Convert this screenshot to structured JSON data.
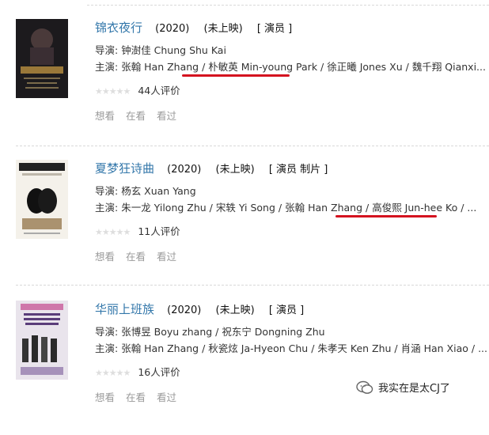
{
  "movies": [
    {
      "title": "锦衣夜行",
      "year": "(2020)",
      "status": "(未上映)",
      "roles": "[ 演员 ]",
      "director_label": "导演: ",
      "director": "钟澍佳 Chung Shu Kai",
      "cast_label": "主演: ",
      "cast": [
        "张翰 Han Zhang",
        "朴敏英 Min-young Park",
        "徐正曦 Jones Xu",
        "魏千翔 Qianxi..."
      ],
      "rating_count": "44人评价",
      "actions": [
        "想看",
        "在看",
        "看过"
      ],
      "poster_colors": {
        "bg": "#1c1a1d",
        "accent": "#b08a3e"
      }
    },
    {
      "title": "夏梦狂诗曲",
      "year": "(2020)",
      "status": "(未上映)",
      "roles": "[ 演员 制片 ]",
      "director_label": "导演: ",
      "director": "杨玄 Xuan Yang",
      "cast_label": "主演: ",
      "cast": [
        "朱一龙 Yilong Zhu",
        "宋轶 Yi Song",
        "张翰 Han Zhang",
        "高俊熙 Jun-hee Ko",
        "..."
      ],
      "rating_count": "11人评价",
      "actions": [
        "想看",
        "在看",
        "看过"
      ],
      "poster_colors": {
        "bg": "#f4f1ea",
        "accent": "#111111"
      }
    },
    {
      "title": "华丽上班族",
      "year": "(2020)",
      "status": "(未上映)",
      "roles": "[ 演员 ]",
      "director_label": "导演: ",
      "director": "张博昱 Boyu zhang / 祝东宁 Dongning Zhu",
      "cast_label": "主演: ",
      "cast": [
        "张翰 Han Zhang",
        "秋瓷炫 Ja-Hyeon Chu",
        "朱孝天 Ken Zhu",
        "肖涵 Han Xiao",
        "..."
      ],
      "rating_count": "16人评价",
      "actions": [
        "想看",
        "在看",
        "看过"
      ],
      "poster_colors": {
        "bg": "#e9e4ec",
        "accent": "#5a3d7a"
      }
    }
  ],
  "colors": {
    "title_link": "#3377aa",
    "highlight_underline": "#d4121f",
    "muted": "#999999"
  },
  "watermark": {
    "text": "我实在是太CJ了",
    "icon": "wechat-icon"
  }
}
